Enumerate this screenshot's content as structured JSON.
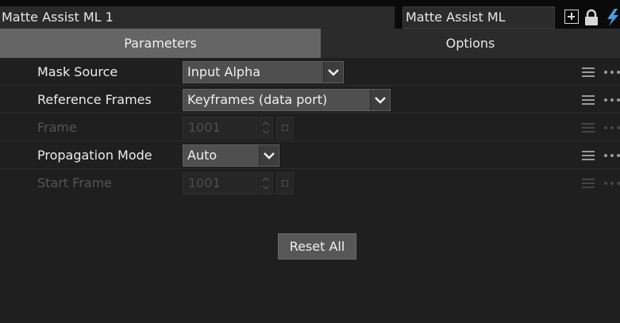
{
  "header": {
    "node_name": "Matte Assist ML 1",
    "node_type": "Matte Assist ML",
    "icons": [
      "plus-box-icon",
      "lock-icon",
      "lightning-bolt-icon"
    ]
  },
  "tabs": [
    {
      "label": "Parameters",
      "active": true
    },
    {
      "label": "Options",
      "active": false
    }
  ],
  "params": [
    {
      "label": "Mask Source",
      "control": "dropdown",
      "value": "Input Alpha",
      "enabled": true
    },
    {
      "label": "Reference Frames",
      "control": "dropdown",
      "value": "Keyframes (data port)",
      "enabled": true
    },
    {
      "label": "Frame",
      "control": "spinbox",
      "value": "1001",
      "enabled": false
    },
    {
      "label": "Propagation Mode",
      "control": "dropdown",
      "value": "Auto",
      "enabled": true
    },
    {
      "label": "Start Frame",
      "control": "spinbox",
      "value": "1001",
      "enabled": false
    }
  ],
  "reset_label": "Reset All",
  "colors": {
    "active_tab": "#656565",
    "panel_bg": "#1f1f1f",
    "accent_bolt": "#4a9de0"
  }
}
